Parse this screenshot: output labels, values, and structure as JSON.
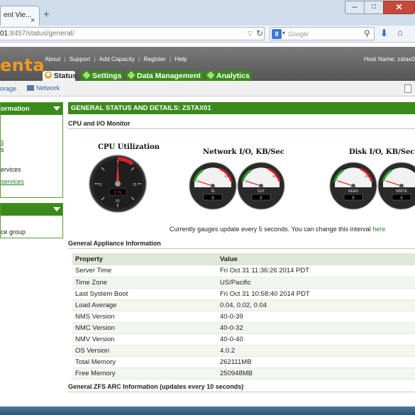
{
  "browser": {
    "tab_title": "ent Vie...",
    "url_host": "01",
    "url_rest": ":8457/status/general/",
    "search_placeholder": "Google"
  },
  "app": {
    "logo": "enta",
    "top_links": [
      "About",
      "Support",
      "Add Capacity",
      "Register",
      "Help"
    ],
    "hostname": "Host Name: zstax0",
    "tabs": [
      "Status",
      "Settings",
      "Data Management",
      "Analytics"
    ],
    "sub_links": {
      "storage": "orage",
      "network": "Network"
    }
  },
  "sidebar": {
    "panel1_title": "ormation",
    "panel1_items": [
      "s",
      "s",
      "ervices",
      "services"
    ],
    "panel2_title": "",
    "panel2_items": [
      "ce group"
    ]
  },
  "main": {
    "section_title": "GENERAL STATUS AND DETAILS: ZSTAX01",
    "cpu_io_title": "CPU and I/O Monitor",
    "cpu_label": "CPU Utilization",
    "network_label": "Network I/O, KB/Sec",
    "disk_label": "Disk I/O, KB/Sec",
    "cpu_value": "0 %",
    "cpu_ticks": [
      "25",
      "75",
      "50"
    ],
    "net_in_label": "IN",
    "net_out_label": "OUT",
    "net_in_value": "0",
    "net_out_value": "0",
    "disk_read_label": "READ",
    "disk_write_label": "WRITE",
    "disk_read_value": "0",
    "disk_write_value": "0",
    "gauge_max": "100",
    "gauge_note": "Currently gauges update every 5 seconds. You can change this interval ",
    "gauge_note_link": "here",
    "appliance_title": "General Appliance Information",
    "arc_title": "General ZFS ARC Information (updates every 10 seconds)",
    "table": {
      "headers": [
        "Property",
        "Value"
      ],
      "rows": [
        [
          "Server Time",
          "Fri Oct 31 11:36:26 2014 PDT"
        ],
        [
          "Time Zone",
          "US/Pacific"
        ],
        [
          "Last System Boot",
          "Fri Oct 31 10:58:40 2014 PDT"
        ],
        [
          "Load Average",
          "0.04, 0.02, 0.04"
        ],
        [
          "NMS Version",
          "40-0-39"
        ],
        [
          "NMC Version",
          "40-0-32"
        ],
        [
          "NMV Version",
          "40-0-40"
        ],
        [
          "OS Version",
          "4.0.2"
        ],
        [
          "Total Memory",
          "262111MB"
        ],
        [
          "Free Memory",
          "250948MB"
        ]
      ]
    }
  },
  "colors": {
    "brand_green": "#3b8a1c",
    "logo_orange": "#f29a1d"
  }
}
